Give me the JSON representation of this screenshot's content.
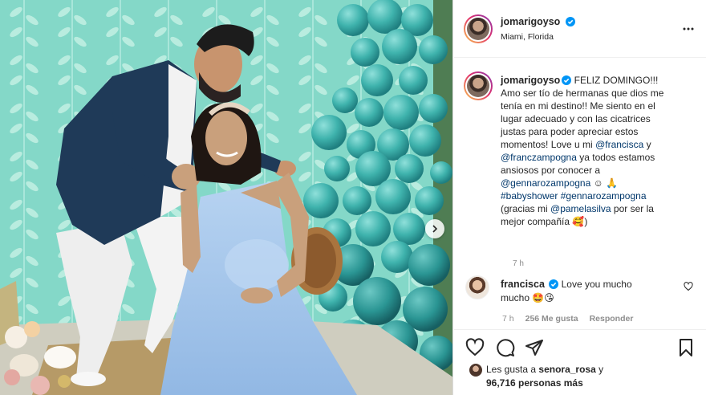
{
  "post": {
    "username": "jomarigoyso",
    "location": "Miami, Florida",
    "caption": {
      "greeting": "FELIZ DOMINGO!!!",
      "line1": "Amo ser tío de hermanas que dios me",
      "line2": "tenía en mi destino!! Me siento en el",
      "line3": "lugar adecuado y con las cicatrices",
      "line4": "justas para poder apreciar estos",
      "line5a": "momentos! Love u mi ",
      "mention1": "@francisca",
      "line5b": " y",
      "mention2": "@franczampogna",
      "line6b": " ya todos estamos",
      "line7": "ansiosos por conocer a",
      "mention3": "@gennarozampogna",
      "emoji1": " ☺ 🙏",
      "hashtag1": "#babyshower",
      "hashtag2": "#gennarozampogna",
      "line10a": "(gracias mi ",
      "mention4": "@pamelasilva",
      "line10b": " por ser la",
      "line11": "mejor compañía 🥰)",
      "time": "7 h"
    },
    "comment": {
      "username": "francisca",
      "text": "Love you mucho",
      "text2": "mucho 🤩😘",
      "time": "7 h",
      "likes": "256 Me gusta",
      "reply": "Responder"
    },
    "liked_by": {
      "prefix": "Les gusta a ",
      "user": "senora_rosa",
      "conj": " y",
      "others": "96,716 personas más"
    }
  },
  "colors": {
    "verified": "#0095f6",
    "mention": "#00376b",
    "backdrop": "#7fd3c4",
    "balloon": "#3fb3ad",
    "dress": "#a9c8ea"
  }
}
